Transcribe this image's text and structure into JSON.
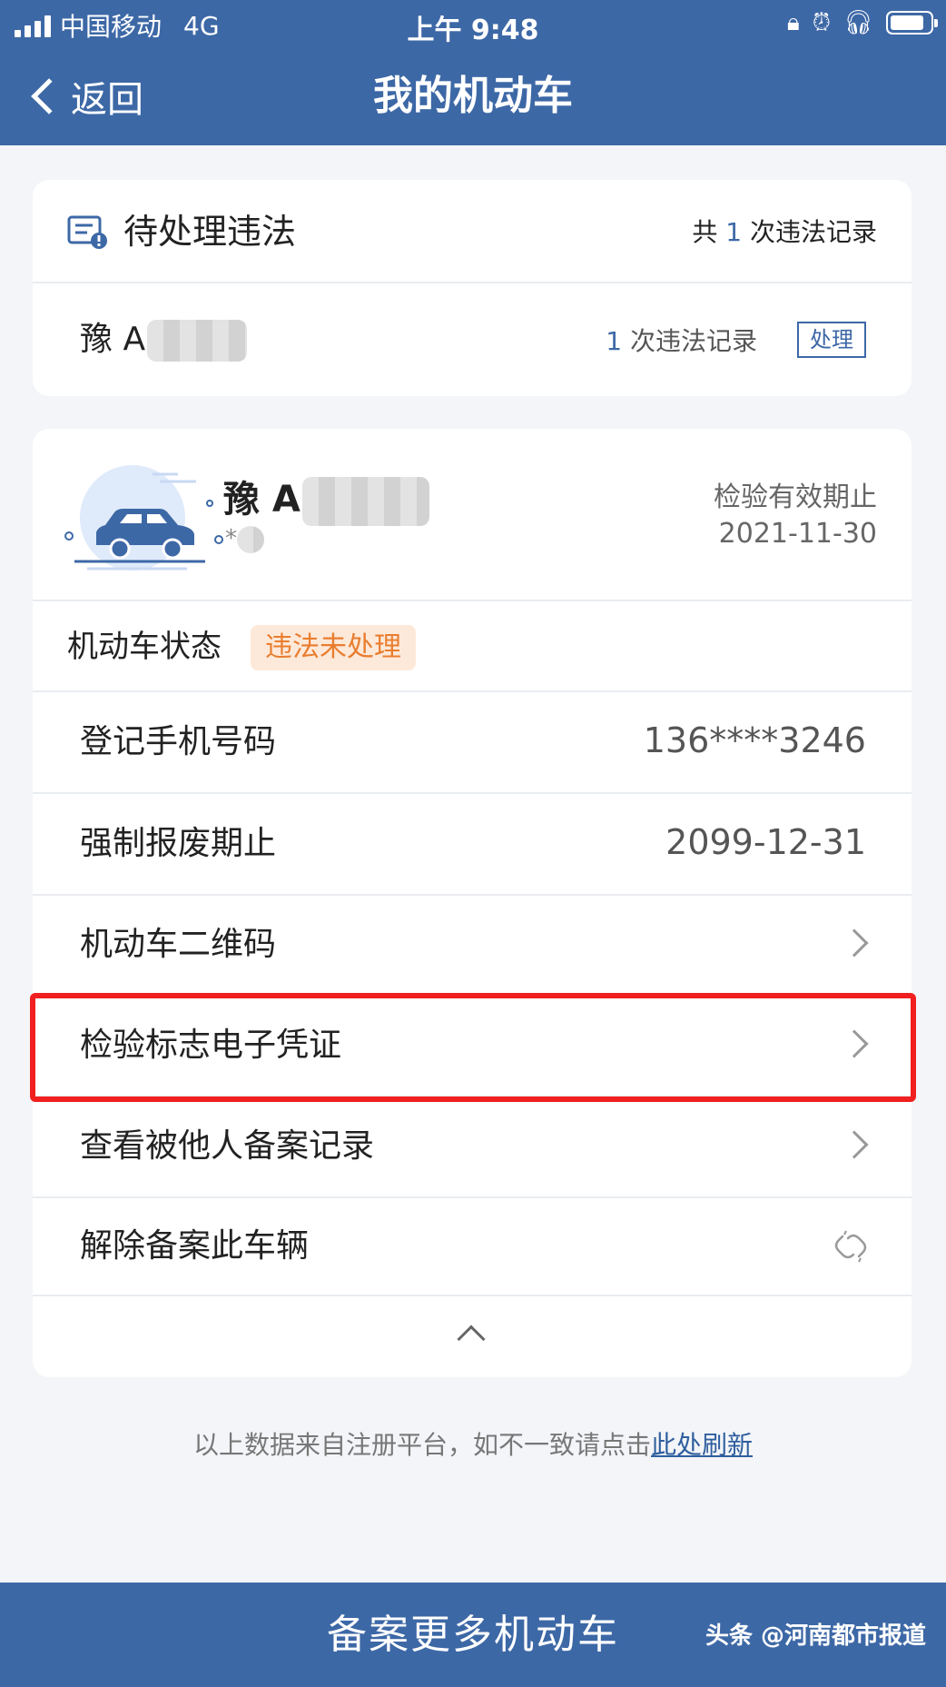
{
  "status_bar": {
    "carrier": "中国移动",
    "network": "4G",
    "time": "上午 9:48"
  },
  "nav": {
    "back_label": "返回",
    "title": "我的机动车"
  },
  "violations": {
    "title": "待处理违法",
    "total_prefix": "共",
    "total_count": "1",
    "total_suffix": "次违法记录",
    "plate": "豫 A",
    "row_count": "1",
    "row_suffix": "次违法记录",
    "handle_label": "处理"
  },
  "vehicle": {
    "plate": "豫 A",
    "plate_sub": "*",
    "inspection_label": "检验有效期止",
    "inspection_date": "2021-11-30",
    "status_label": "机动车状态",
    "status_badge": "违法未处理",
    "rows": [
      {
        "label": "登记手机号码",
        "value": "136****3246"
      },
      {
        "label": "强制报废期止",
        "value": "2099-12-31"
      },
      {
        "label": "机动车二维码"
      },
      {
        "label": "检验标志电子凭证"
      },
      {
        "label": "查看被他人备案记录"
      },
      {
        "label": "解除备案此车辆"
      }
    ]
  },
  "footer_note": {
    "text": "以上数据来自注册平台，如不一致请点击",
    "link": "此处刷新"
  },
  "bottom_button": "备案更多机动车",
  "watermark": "头条 @河南都市报道",
  "colors": {
    "brand_blue": "#3d68a6",
    "badge_orange": "#e97d2f",
    "badge_bg": "#fde9d9",
    "highlight_red": "#f11f1f"
  }
}
